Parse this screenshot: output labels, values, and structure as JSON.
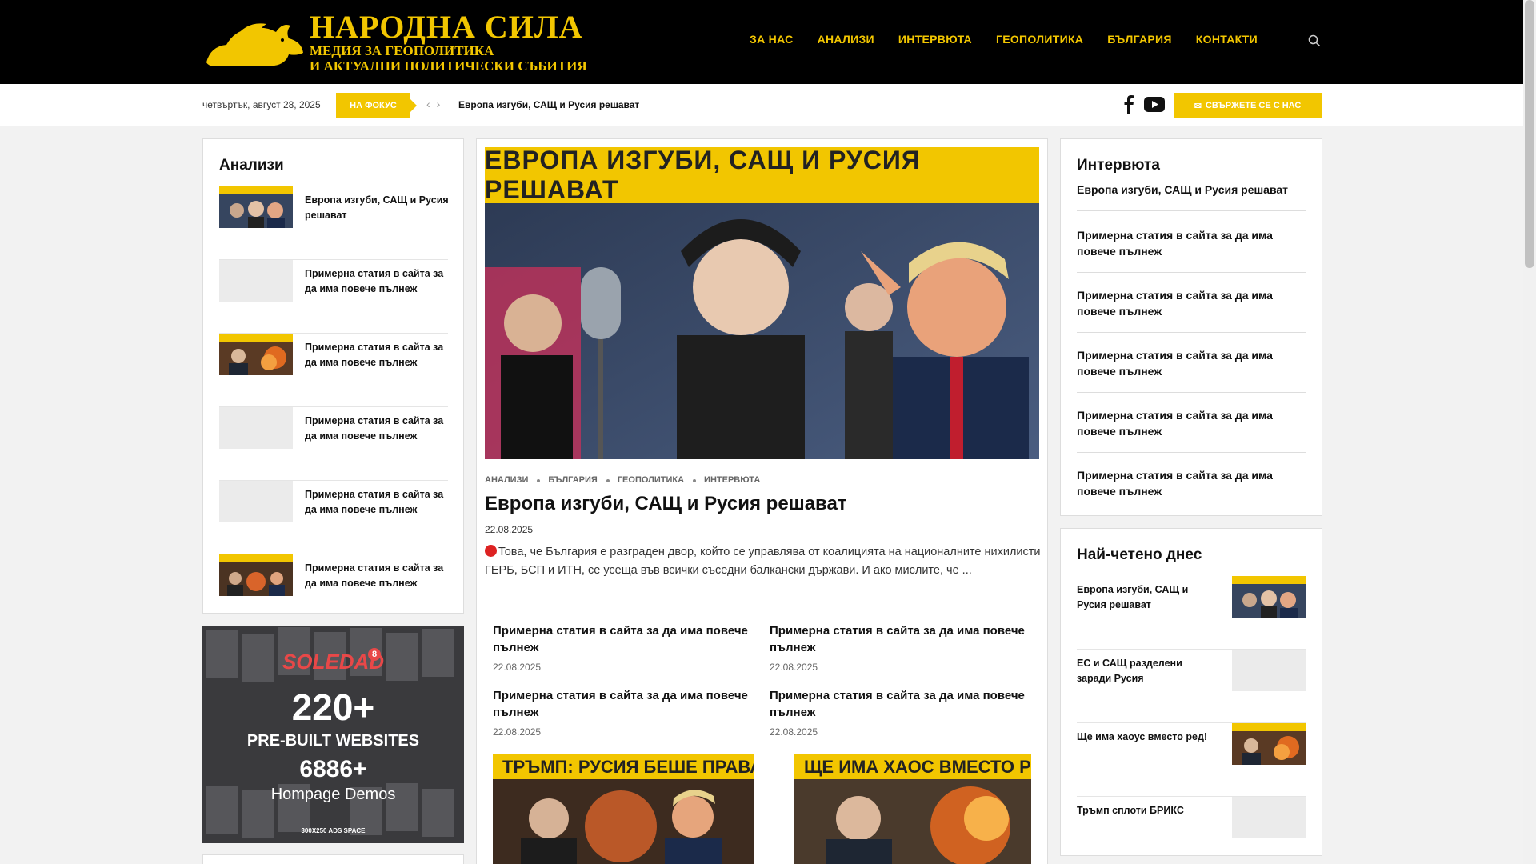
{
  "site": {
    "logo_title": "НАРОДНА СИЛА",
    "logo_subtitle_1": "МЕДИЯ ЗА ГЕОПОЛИТИКА",
    "logo_subtitle_2": "И АКТУАЛНИ ПОЛИТИЧЕСКИ СЪБИТИЯ"
  },
  "nav": {
    "items": [
      "ЗА НАС",
      "АНАЛИЗИ",
      "ИНТЕРВЮТА",
      "ГЕОПОЛИТИКА",
      "БЪЛГАРИЯ",
      "КОНТАКТИ"
    ]
  },
  "topbar": {
    "date": "четвъртък, август 28, 2025",
    "focus_label": "НА ФОКУС",
    "headline": "Европа изгуби, САЩ и Русия решават",
    "contact_label": "СВЪРЖЕТЕ СЕ С НАС"
  },
  "left_widget": {
    "title": "Анализи",
    "items": [
      "Европа изгуби, САЩ и Русия решават",
      "Примерна статия в сайта за да има повече пълнеж",
      "Примерна статия в сайта за да има повече пълнеж",
      "Примерна статия в сайта за да има повече пълнеж",
      "Примерна статия в сайта за да има повече пълнеж",
      "Примерна статия в сайта за да има повече пълнеж"
    ]
  },
  "ad": {
    "brand": "SOLEDAD",
    "badge": "8",
    "big": "220+",
    "mid": "PRE-BUILT WEBSITES",
    "big2": "6886+",
    "mid2": "Hompage Demos",
    "small": "300X250 ADS SPACE"
  },
  "main": {
    "hero_banner": "ЕВРОПА ИЗГУБИ, САЩ И РУСИЯ РЕШАВАТ",
    "categories": [
      "АНАЛИЗИ",
      "БЪЛГАРИЯ",
      "ГЕОПОЛИТИКА",
      "ИНТЕРВЮТА"
    ],
    "title": "Европа изгуби, САЩ и Русия решават",
    "date": "22.08.2025",
    "excerpt": "Това, че България е разграден двор, който се управлява от коалицията на националните нихилисти ГЕРБ, БСП и ИТН, се усеща във всички съседни балкански държави. И ако мислите, че ...",
    "grid": [
      {
        "title": "Примерна статия в сайта за да има повече пълнеж",
        "date": "22.08.2025"
      },
      {
        "title": "Примерна статия в сайта за да има повече пълнеж",
        "date": "22.08.2025"
      },
      {
        "title": "Примерна статия в сайта за да има повече пълнеж",
        "date": "22.08.2025"
      },
      {
        "title": "Примерна статия в сайта за да има повече пълнеж",
        "date": "22.08.2025"
      }
    ],
    "thumb1_banner": "ТРЪМП: РУСИЯ БЕШЕ ПРАВА!",
    "thumb2_banner": "ЩЕ ИМА ХАОС ВМЕСТО РЕ"
  },
  "right_widget": {
    "title": "Интервюта",
    "items": [
      "Европа изгуби, САЩ и Русия решават",
      "Примерна статия в сайта за да има повече пълнеж",
      "Примерна статия в сайта за да има повече пълнеж",
      "Примерна статия в сайта за да има повече пълнеж",
      "Примерна статия в сайта за да има повече пълнеж",
      "Примерна статия в сайта за да има повече пълнеж"
    ]
  },
  "popular_widget": {
    "title": "Най-четено днес",
    "items": [
      "Европа изгуби, САЩ и Русия решават",
      "ЕС и САЩ разделени заради Русия",
      "Ще има хаоус вместо ред!",
      "Тръмп сплоти БРИКС"
    ]
  },
  "colors": {
    "accent": "#f2c600",
    "header_bg": "#000000"
  }
}
